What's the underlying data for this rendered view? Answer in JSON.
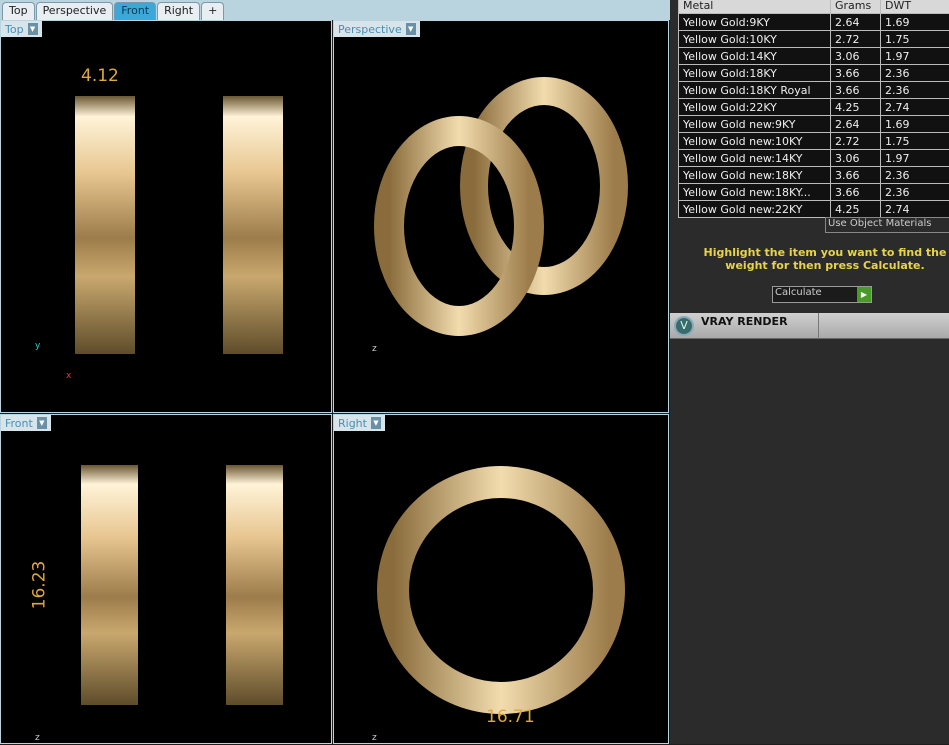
{
  "tabs": [
    {
      "label": "Top"
    },
    {
      "label": "Perspective"
    },
    {
      "label": "Front",
      "active": true
    },
    {
      "label": "Right"
    },
    {
      "label": "+"
    }
  ],
  "viewports": {
    "top": {
      "label": "Top",
      "dimension": "4.12"
    },
    "perspective": {
      "label": "Perspective"
    },
    "front": {
      "label": "Front",
      "dimension": "16.23"
    },
    "right": {
      "label": "Right",
      "dimension": "16.71"
    }
  },
  "axes": {
    "x": "x",
    "y": "y",
    "z": "z"
  },
  "weights": {
    "headers": [
      "Metal",
      "Grams",
      "DWT"
    ],
    "rows": [
      [
        "Yellow Gold:9KY",
        "2.64",
        "1.69"
      ],
      [
        "Yellow Gold:10KY",
        "2.72",
        "1.75"
      ],
      [
        "Yellow Gold:14KY",
        "3.06",
        "1.97"
      ],
      [
        "Yellow Gold:18KY",
        "3.66",
        "2.36"
      ],
      [
        "Yellow Gold:18KY Royal",
        "3.66",
        "2.36"
      ],
      [
        "Yellow Gold:22KY",
        "4.25",
        "2.74"
      ],
      [
        "Yellow Gold new:9KY",
        "2.64",
        "1.69"
      ],
      [
        "Yellow Gold new:10KY",
        "2.72",
        "1.75"
      ],
      [
        "Yellow Gold new:14KY",
        "3.06",
        "1.97"
      ],
      [
        "Yellow Gold new:18KY",
        "3.66",
        "2.36"
      ],
      [
        "Yellow Gold new:18KY...",
        "3.66",
        "2.36"
      ],
      [
        "Yellow Gold new:22KY",
        "4.25",
        "2.74"
      ]
    ]
  },
  "materials_select": "Use Object Materials",
  "instruction": "Highlight the item you want to find the weight for then press Calculate.",
  "calculate_label": "Calculate",
  "vray_label": "VRAY RENDER",
  "colors": {
    "gold": "#e7c690",
    "dimension": "#e0a93c",
    "active_tab": "#3aa8d8",
    "instruction": "#e8d44a"
  }
}
